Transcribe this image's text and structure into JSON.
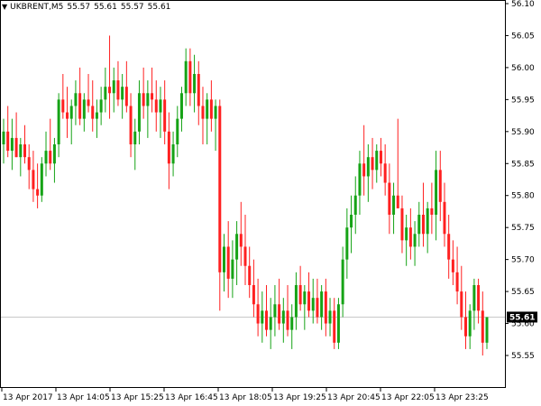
{
  "header": {
    "symbol": "UKBRENT,M5",
    "open": "55.57",
    "high": "55.61",
    "low": "55.57",
    "close": "55.61"
  },
  "colors": {
    "bull": "#16a316",
    "bear": "#ff2020",
    "current_line": "#c8c8c8",
    "current_label_bg": "#000000"
  },
  "chart_data": {
    "type": "candlestick",
    "y_range": [
      55.52,
      56.1
    ],
    "y_ticks": [
      "56.10",
      "56.05",
      "56.00",
      "55.95",
      "55.90",
      "55.85",
      "55.80",
      "55.75",
      "55.70",
      "55.65",
      "55.60",
      "55.55"
    ],
    "x_ticks": [
      "13 Apr 2017",
      "13 Apr 14:05",
      "13 Apr 15:25",
      "13 Apr 16:45",
      "13 Apr 18:05",
      "13 Apr 19:25",
      "13 Apr 20:45",
      "13 Apr 22:05",
      "13 Apr 23:25"
    ],
    "current_price": "55.61",
    "candles": [
      [
        55.88,
        55.92,
        55.85,
        55.9
      ],
      [
        55.9,
        55.94,
        55.86,
        55.87
      ],
      [
        55.87,
        55.92,
        55.84,
        55.89
      ],
      [
        55.89,
        55.93,
        55.86,
        55.86
      ],
      [
        55.86,
        55.89,
        55.83,
        55.88
      ],
      [
        55.88,
        55.91,
        55.85,
        55.86
      ],
      [
        55.86,
        55.88,
        55.81,
        55.84
      ],
      [
        55.84,
        55.87,
        55.79,
        55.81
      ],
      [
        55.81,
        55.85,
        55.78,
        55.8
      ],
      [
        55.8,
        55.86,
        55.79,
        55.85
      ],
      [
        55.85,
        55.9,
        55.83,
        55.87
      ],
      [
        55.87,
        55.92,
        55.84,
        55.85
      ],
      [
        55.85,
        55.89,
        55.82,
        55.88
      ],
      [
        55.88,
        55.96,
        55.86,
        55.95
      ],
      [
        55.95,
        55.99,
        55.92,
        55.93
      ],
      [
        55.93,
        55.97,
        55.89,
        55.92
      ],
      [
        55.92,
        55.95,
        55.88,
        55.94
      ],
      [
        55.94,
        55.98,
        55.91,
        55.96
      ],
      [
        55.96,
        56.0,
        55.91,
        55.92
      ],
      [
        55.92,
        55.96,
        55.9,
        55.95
      ],
      [
        55.95,
        55.99,
        55.93,
        55.94
      ],
      [
        55.94,
        55.98,
        55.9,
        55.92
      ],
      [
        55.92,
        55.95,
        55.89,
        55.93
      ],
      [
        55.93,
        55.97,
        55.91,
        55.95
      ],
      [
        55.95,
        56.0,
        55.93,
        55.97
      ],
      [
        55.97,
        56.05,
        55.92,
        55.96
      ],
      [
        55.96,
        56.0,
        55.93,
        55.98
      ],
      [
        55.98,
        56.01,
        55.94,
        55.95
      ],
      [
        55.95,
        55.99,
        55.92,
        55.97
      ],
      [
        55.97,
        56.01,
        55.93,
        55.94
      ],
      [
        55.94,
        55.96,
        55.86,
        55.88
      ],
      [
        55.88,
        55.92,
        55.84,
        55.9
      ],
      [
        55.9,
        55.98,
        55.88,
        55.96
      ],
      [
        55.96,
        56.0,
        55.92,
        55.94
      ],
      [
        55.94,
        55.98,
        55.89,
        55.96
      ],
      [
        55.96,
        56.0,
        55.93,
        55.95
      ],
      [
        55.95,
        55.98,
        55.9,
        55.93
      ],
      [
        55.93,
        55.97,
        55.89,
        55.95
      ],
      [
        55.95,
        55.98,
        55.88,
        55.9
      ],
      [
        55.9,
        55.93,
        55.81,
        55.85
      ],
      [
        55.85,
        55.9,
        55.83,
        55.88
      ],
      [
        55.88,
        55.94,
        55.86,
        55.92
      ],
      [
        55.92,
        55.97,
        55.9,
        55.96
      ],
      [
        55.96,
        56.03,
        55.94,
        56.01
      ],
      [
        56.01,
        56.03,
        55.94,
        55.96
      ],
      [
        55.96,
        56.02,
        55.93,
        55.99
      ],
      [
        55.99,
        56.01,
        55.91,
        55.94
      ],
      [
        55.94,
        55.97,
        55.88,
        55.92
      ],
      [
        55.92,
        55.96,
        55.88,
        55.95
      ],
      [
        55.95,
        55.98,
        55.9,
        55.92
      ],
      [
        55.92,
        55.95,
        55.87,
        55.94
      ],
      [
        55.94,
        55.95,
        55.62,
        55.68
      ],
      [
        55.68,
        55.74,
        55.65,
        55.72
      ],
      [
        55.72,
        55.76,
        55.64,
        55.67
      ],
      [
        55.67,
        55.73,
        55.64,
        55.7
      ],
      [
        55.7,
        55.76,
        55.66,
        55.74
      ],
      [
        55.74,
        55.79,
        55.69,
        55.72
      ],
      [
        55.72,
        55.77,
        55.66,
        55.69
      ],
      [
        55.69,
        55.72,
        55.64,
        55.66
      ],
      [
        55.66,
        55.7,
        55.61,
        55.63
      ],
      [
        55.63,
        55.67,
        55.58,
        55.6
      ],
      [
        55.6,
        55.65,
        55.57,
        55.62
      ],
      [
        55.62,
        55.66,
        55.58,
        55.59
      ],
      [
        55.59,
        55.64,
        55.56,
        55.61
      ],
      [
        55.61,
        55.66,
        55.58,
        55.63
      ],
      [
        55.63,
        55.67,
        55.59,
        55.6
      ],
      [
        55.6,
        55.64,
        55.57,
        55.62
      ],
      [
        55.62,
        55.66,
        55.58,
        55.59
      ],
      [
        55.59,
        55.63,
        55.56,
        55.61
      ],
      [
        55.61,
        55.68,
        55.59,
        55.66
      ],
      [
        55.66,
        55.69,
        55.62,
        55.63
      ],
      [
        55.63,
        55.66,
        55.59,
        55.65
      ],
      [
        55.65,
        55.68,
        55.61,
        55.62
      ],
      [
        55.62,
        55.67,
        55.6,
        55.64
      ],
      [
        55.64,
        55.67,
        55.6,
        55.61
      ],
      [
        55.61,
        55.66,
        55.59,
        55.65
      ],
      [
        55.65,
        55.67,
        55.58,
        55.6
      ],
      [
        55.6,
        55.64,
        55.58,
        55.62
      ],
      [
        55.62,
        55.64,
        55.56,
        55.57
      ],
      [
        55.57,
        55.64,
        55.56,
        55.63
      ],
      [
        55.63,
        55.72,
        55.61,
        55.7
      ],
      [
        55.7,
        55.78,
        55.67,
        55.75
      ],
      [
        55.75,
        55.8,
        55.71,
        55.77
      ],
      [
        55.77,
        55.83,
        55.74,
        55.8
      ],
      [
        55.8,
        55.87,
        55.77,
        55.85
      ],
      [
        55.85,
        55.91,
        55.8,
        55.83
      ],
      [
        55.83,
        55.88,
        55.79,
        55.86
      ],
      [
        55.86,
        55.89,
        55.81,
        55.84
      ],
      [
        55.84,
        55.88,
        55.82,
        55.87
      ],
      [
        55.87,
        55.89,
        55.83,
        55.85
      ],
      [
        55.85,
        55.88,
        55.8,
        55.82
      ],
      [
        55.82,
        55.85,
        55.74,
        55.77
      ],
      [
        55.77,
        55.82,
        55.74,
        55.8
      ],
      [
        55.8,
        55.92,
        55.78,
        55.78
      ],
      [
        55.78,
        55.8,
        55.71,
        55.73
      ],
      [
        55.73,
        55.77,
        55.69,
        55.75
      ],
      [
        55.75,
        55.78,
        55.7,
        55.72
      ],
      [
        55.72,
        55.76,
        55.69,
        55.74
      ],
      [
        55.74,
        55.79,
        55.72,
        55.77
      ],
      [
        55.77,
        55.82,
        55.72,
        55.74
      ],
      [
        55.74,
        55.79,
        55.71,
        55.78
      ],
      [
        55.78,
        55.82,
        55.74,
        55.77
      ],
      [
        55.77,
        55.87,
        55.73,
        55.84
      ],
      [
        55.84,
        55.87,
        55.76,
        55.79
      ],
      [
        55.79,
        55.82,
        55.72,
        55.74
      ],
      [
        55.74,
        55.77,
        55.67,
        55.7
      ],
      [
        55.7,
        55.73,
        55.66,
        55.68
      ],
      [
        55.68,
        55.72,
        55.63,
        55.65
      ],
      [
        55.65,
        55.69,
        55.59,
        55.61
      ],
      [
        55.61,
        55.65,
        55.56,
        55.58
      ],
      [
        55.58,
        55.63,
        55.56,
        55.62
      ],
      [
        55.62,
        55.67,
        55.59,
        55.66
      ],
      [
        55.66,
        55.67,
        55.6,
        55.62
      ],
      [
        55.62,
        55.65,
        55.55,
        55.57
      ],
      [
        55.57,
        55.61,
        55.56,
        55.61
      ]
    ]
  }
}
